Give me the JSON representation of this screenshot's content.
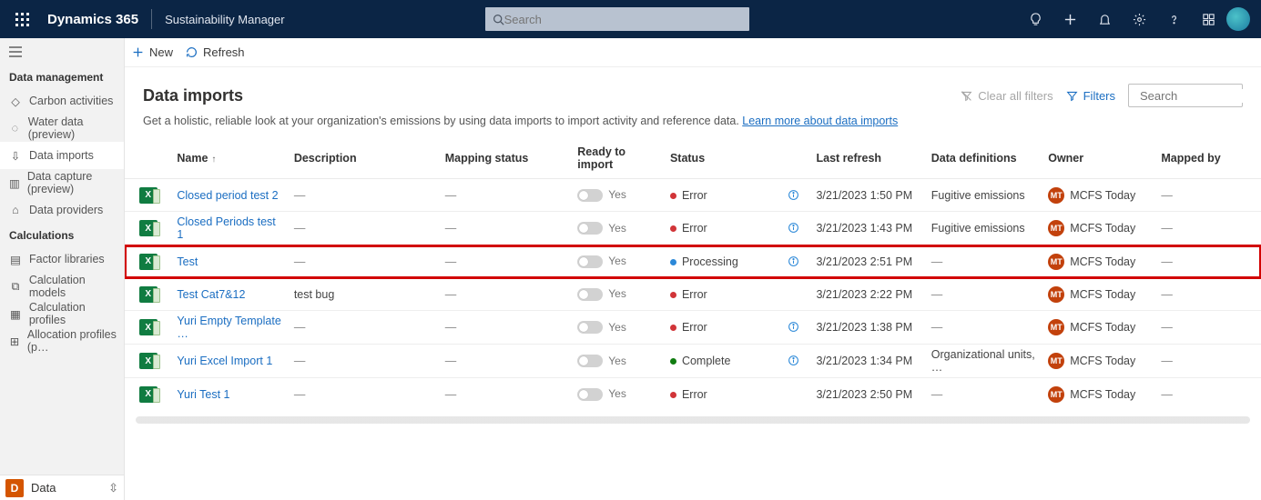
{
  "topbar": {
    "brand": "Dynamics 365",
    "app_name": "Sustainability Manager",
    "search_placeholder": "Search"
  },
  "sidebar": {
    "section1": "Data management",
    "items1": [
      {
        "label": "Carbon activities"
      },
      {
        "label": "Water data (preview)"
      },
      {
        "label": "Data imports"
      },
      {
        "label": "Data capture (preview)"
      },
      {
        "label": "Data providers"
      }
    ],
    "section2": "Calculations",
    "items2": [
      {
        "label": "Factor libraries"
      },
      {
        "label": "Calculation models"
      },
      {
        "label": "Calculation profiles"
      },
      {
        "label": "Allocation profiles (p…"
      }
    ],
    "footer_letter": "D",
    "footer_label": "Data"
  },
  "commands": {
    "new": "New",
    "refresh": "Refresh"
  },
  "page": {
    "title": "Data imports",
    "subtitle_pre": "Get a holistic, reliable look at your organization's emissions by using data imports to import activity and reference data. ",
    "subtitle_link": "Learn more about data imports",
    "clear_filters": "Clear all filters",
    "filters": "Filters",
    "search_placeholder": "Search"
  },
  "columns": {
    "name": "Name",
    "description": "Description",
    "mapping": "Mapping status",
    "ready": "Ready to import",
    "status": "Status",
    "refresh": "Last refresh",
    "def": "Data definitions",
    "owner": "Owner",
    "mapped": "Mapped by"
  },
  "ready_yes": "Yes",
  "status_labels": {
    "error": "Error",
    "processing": "Processing",
    "complete": "Complete"
  },
  "rows": [
    {
      "name": "Closed period test 2",
      "desc": "—",
      "map": "—",
      "ready": "Yes",
      "status": "error",
      "info": true,
      "refresh": "3/21/2023 1:50 PM",
      "def": "Fugitive emissions",
      "owner": "MCFS Today",
      "mapped": "—",
      "highlight": false
    },
    {
      "name": "Closed Periods test 1",
      "desc": "—",
      "map": "—",
      "ready": "Yes",
      "status": "error",
      "info": true,
      "refresh": "3/21/2023 1:43 PM",
      "def": "Fugitive emissions",
      "owner": "MCFS Today",
      "mapped": "—",
      "highlight": false
    },
    {
      "name": "Test",
      "desc": "—",
      "map": "—",
      "ready": "Yes",
      "status": "processing",
      "info": true,
      "refresh": "3/21/2023 2:51 PM",
      "def": "—",
      "owner": "MCFS Today",
      "mapped": "—",
      "highlight": true
    },
    {
      "name": "Test Cat7&12",
      "desc": "test bug",
      "map": "—",
      "ready": "Yes",
      "status": "error",
      "info": false,
      "refresh": "3/21/2023 2:22 PM",
      "def": "—",
      "owner": "MCFS Today",
      "mapped": "—",
      "highlight": false
    },
    {
      "name": "Yuri Empty Template …",
      "desc": "—",
      "map": "—",
      "ready": "Yes",
      "status": "error",
      "info": true,
      "refresh": "3/21/2023 1:38 PM",
      "def": "—",
      "owner": "MCFS Today",
      "mapped": "—",
      "highlight": false
    },
    {
      "name": "Yuri Excel Import 1",
      "desc": "—",
      "map": "—",
      "ready": "Yes",
      "status": "complete",
      "info": true,
      "refresh": "3/21/2023 1:34 PM",
      "def": "Organizational units, …",
      "owner": "MCFS Today",
      "mapped": "—",
      "highlight": false
    },
    {
      "name": "Yuri Test 1",
      "desc": "—",
      "map": "—",
      "ready": "Yes",
      "status": "error",
      "info": false,
      "refresh": "3/21/2023 2:50 PM",
      "def": "—",
      "owner": "MCFS Today",
      "mapped": "—",
      "highlight": false
    }
  ]
}
